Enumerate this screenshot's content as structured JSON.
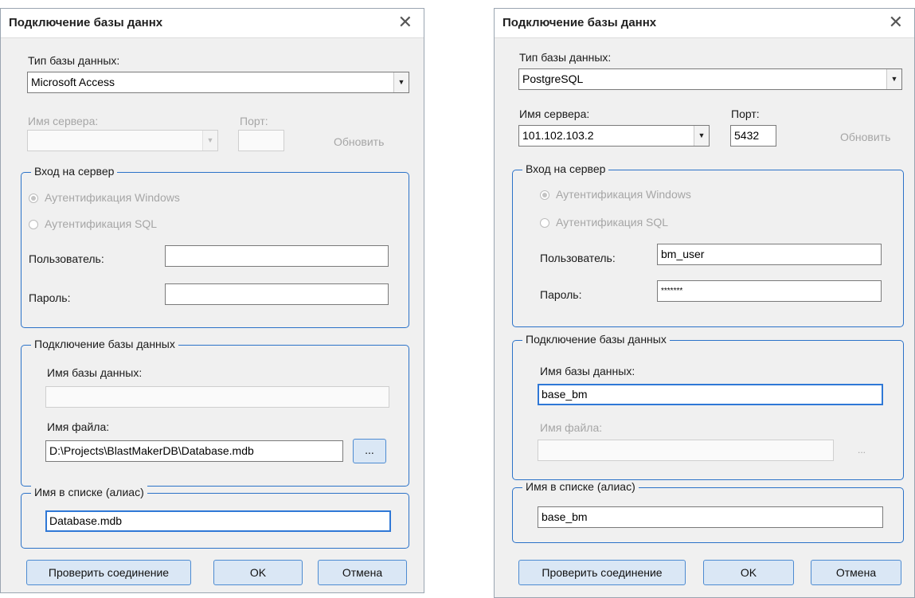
{
  "left": {
    "title": "Подключение базы даннх",
    "db_type_label": "Тип базы данных:",
    "db_type_value": "Microsoft Access",
    "server_label": "Имя сервера:",
    "server_value": "",
    "port_label": "Порт:",
    "port_value": "",
    "refresh_label": "Обновить",
    "login_group": "Вход на сервер",
    "auth_windows": "Аутентификация Windows",
    "auth_sql": "Аутентификация SQL",
    "user_label": "Пользователь:",
    "user_value": "",
    "password_label": "Пароль:",
    "password_value": "",
    "db_group": "Подключение базы данных",
    "db_name_label": "Имя базы данных:",
    "db_name_value": "",
    "file_label": "Имя файла:",
    "file_value": "D:\\Projects\\BlastMakerDB\\Database.mdb",
    "browse_label": "...",
    "alias_group": "Имя в списке (алиас)",
    "alias_value": "Database.mdb",
    "test_button": "Проверить соединение",
    "ok_button": "OK",
    "cancel_button": "Отмена"
  },
  "right": {
    "title": "Подключение базы даннх",
    "db_type_label": "Тип базы данных:",
    "db_type_value": "PostgreSQL",
    "server_label": "Имя сервера:",
    "server_value": "101.102.103.2",
    "port_label": "Порт:",
    "port_value": "5432",
    "refresh_label": "Обновить",
    "login_group": "Вход на сервер",
    "auth_windows": "Аутентификация Windows",
    "auth_sql": "Аутентификация SQL",
    "user_label": "Пользователь:",
    "user_value": "bm_user",
    "password_label": "Пароль:",
    "password_value": "*******",
    "db_group": "Подключение базы данных",
    "db_name_label": "Имя базы данных:",
    "db_name_value": "base_bm",
    "file_label": "Имя файла:",
    "file_value": "",
    "browse_label": "...",
    "alias_group": "Имя в списке (алиас)",
    "alias_value": "base_bm",
    "test_button": "Проверить соединение",
    "ok_button": "OK",
    "cancel_button": "Отмена"
  },
  "icons": {
    "close": "close-icon",
    "dropdown": "chevron-down-icon"
  }
}
